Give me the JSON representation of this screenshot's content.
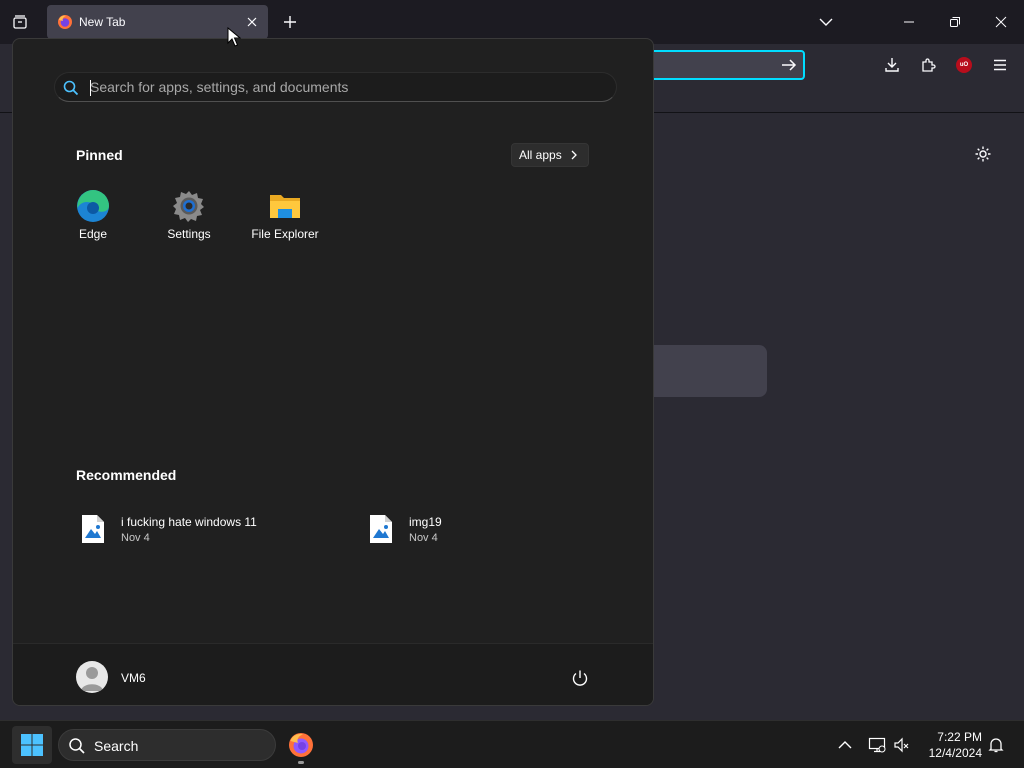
{
  "browser": {
    "tab": {
      "title": "New Tab"
    },
    "new_tab_label": "+"
  },
  "start_menu": {
    "search_placeholder": "Search for apps, settings, and documents",
    "pinned_title": "Pinned",
    "all_apps_label": "All apps",
    "pinned": [
      {
        "label": "Edge",
        "icon": "edge-icon"
      },
      {
        "label": "Settings",
        "icon": "settings-gear-icon"
      },
      {
        "label": "File Explorer",
        "icon": "folder-icon"
      }
    ],
    "recommended_title": "Recommended",
    "recommended": [
      {
        "name": "i fucking hate windows 11",
        "date": "Nov 4",
        "icon": "image-file-icon"
      },
      {
        "name": "img19",
        "date": "Nov 4",
        "icon": "image-file-icon"
      }
    ],
    "user_name": "VM6"
  },
  "taskbar": {
    "search_label": "Search",
    "time": "7:22 PM",
    "date": "12/4/2024"
  },
  "colors": {
    "accent": "#00ddff",
    "start_bg": "#202020",
    "taskbar_bg": "#1c1c1c",
    "browser_bg": "#2b2a33"
  }
}
